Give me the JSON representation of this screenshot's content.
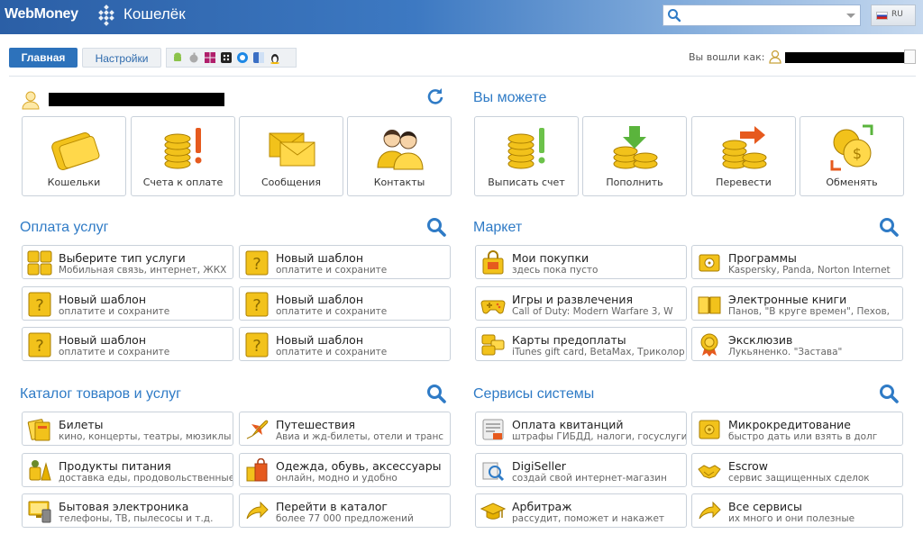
{
  "header": {
    "logo_text": "WebMoney",
    "app_name": "Кошелёк",
    "language": "RU"
  },
  "tabs": [
    {
      "label": "Главная"
    },
    {
      "label": "Настройки"
    }
  ],
  "login": {
    "label": "Вы вошли как:"
  },
  "sections": {
    "you_can": "Вы можете",
    "payments": "Оплата услуг",
    "market": "Маркет",
    "catalog": "Каталог товаров и услуг",
    "services": "Сервисы системы"
  },
  "tiles_left": [
    {
      "label": "Кошельки",
      "icon": "wallet-icon"
    },
    {
      "label": "Счета к оплате",
      "icon": "coins-exclamation-icon"
    },
    {
      "label": "Сообщения",
      "icon": "envelope-icon"
    },
    {
      "label": "Контакты",
      "icon": "contacts-icon"
    }
  ],
  "tiles_right": [
    {
      "label": "Выписать счет",
      "icon": "invoice-icon"
    },
    {
      "label": "Пополнить",
      "icon": "topup-icon"
    },
    {
      "label": "Перевести",
      "icon": "transfer-icon"
    },
    {
      "label": "Обменять",
      "icon": "exchange-icon"
    }
  ],
  "payments": [
    {
      "title": "Выберите тип услуги",
      "sub": "Мобильная связь, интернет, ЖКХ"
    },
    {
      "title": "Новый шаблон",
      "sub": "оплатите и сохраните"
    },
    {
      "title": "Новый шаблон",
      "sub": "оплатите и сохраните"
    },
    {
      "title": "Новый шаблон",
      "sub": "оплатите и сохраните"
    },
    {
      "title": "Новый шаблон",
      "sub": "оплатите и сохраните"
    },
    {
      "title": "Новый шаблон",
      "sub": "оплатите и сохраните"
    }
  ],
  "market": [
    {
      "title": "Мои покупки",
      "sub": "здесь пока пусто"
    },
    {
      "title": "Программы",
      "sub": "Kaspersky, Panda, Norton Internet"
    },
    {
      "title": "Игры и развлечения",
      "sub": "Call of Duty: Modern Warfare 3, W"
    },
    {
      "title": "Электронные книги",
      "sub": "Панов, \"В круге времен\", Пехов,"
    },
    {
      "title": "Карты предоплаты",
      "sub": "iTunes gift card, BetaMax, Триколор"
    },
    {
      "title": "Эксклюзив",
      "sub": "Лукьяненко. \"Застава\""
    }
  ],
  "catalog": [
    {
      "title": "Билеты",
      "sub": "кино, концерты, театры, мюзиклы"
    },
    {
      "title": "Путешествия",
      "sub": "Авиа и жд-билеты, отели и транс"
    },
    {
      "title": "Продукты питания",
      "sub": "доставка еды, продовольственные"
    },
    {
      "title": "Одежда, обувь, аксессуары",
      "sub": "онлайн, модно и удобно"
    },
    {
      "title": "Бытовая электроника",
      "sub": "телефоны, ТВ, пылесосы и т.д."
    },
    {
      "title": "Перейти в каталог",
      "sub": "более 77 000 предложений"
    }
  ],
  "services": [
    {
      "title": "Оплата квитанций",
      "sub": "штрафы ГИБДД, налоги, госуслуги"
    },
    {
      "title": "Микрокредитование",
      "sub": "быстро дать или взять в долг"
    },
    {
      "title": "DigiSeller",
      "sub": "создай свой интернет-магазин"
    },
    {
      "title": "Escrow",
      "sub": "сервис защищенных сделок"
    },
    {
      "title": "Арбитраж",
      "sub": "рассудит, поможет и накажет"
    },
    {
      "title": "Все сервисы",
      "sub": "их много и они полезные"
    }
  ],
  "colors": {
    "accent": "#2f7bc6",
    "header": "#2b5fa6",
    "icon_yellow": "#f2c21b"
  }
}
